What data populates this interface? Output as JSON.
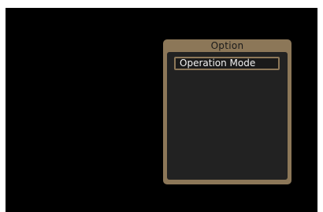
{
  "option_menu": {
    "title": "Option",
    "items": [
      {
        "label": "Operation Mode",
        "selected": true
      }
    ]
  },
  "colors": {
    "page_background": "#ffffff",
    "screen_background": "#000000",
    "panel_frame": "#8c7758",
    "panel_body": "#222222",
    "item_text": "#f2f2f2"
  }
}
